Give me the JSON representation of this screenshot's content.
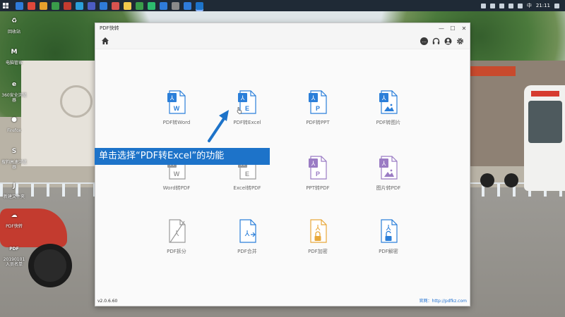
{
  "taskbar": {
    "clock": "21:11",
    "ime": "中",
    "app_colors": [
      "#2f7bd9",
      "#e0483b",
      "#e7a12c",
      "#3a9c4a",
      "#c33b2f",
      "#2b9fd9",
      "#4c5cc2",
      "#2f7bd9",
      "#d9534f",
      "#f2c94c",
      "#3a9c4a",
      "#2dbb6e",
      "#2f7bd9",
      "#8a8a8a",
      "#2f7bd9",
      "#1d73c9"
    ]
  },
  "desktop": {
    "icons": [
      {
        "label": "回收站",
        "glyph": "♻",
        "color": "#5c8fc4",
        "icon": "recycle-bin-icon"
      },
      {
        "label": "电脑管家",
        "glyph": "M",
        "color": "#2d3a8c",
        "icon": "computer-manager-icon"
      },
      {
        "label": "360安全浏览器",
        "glyph": "e",
        "color": "#38a84b",
        "icon": "browser-360-icon"
      },
      {
        "label": "Firefox",
        "glyph": "●",
        "color": "#e66a21",
        "icon": "firefox-icon"
      },
      {
        "label": "搜狗高速浏览器",
        "glyph": "S",
        "color": "#2b7fd9",
        "icon": "sogou-browser-icon"
      },
      {
        "label": "新建文件夹",
        "glyph": "J",
        "color": "#e2c15a",
        "icon": "folder-icon"
      },
      {
        "label": "PDF快转",
        "glyph": "☁",
        "color": "#1e78d6",
        "icon": "pdfkz-app-icon"
      },
      {
        "label": "20190101入员名单",
        "glyph": "PDF",
        "color": "#d93a2f",
        "icon": "pdf-file-icon"
      }
    ]
  },
  "window": {
    "title": "PDF快转",
    "minimize": "—",
    "maximize": "☐",
    "close": "✕",
    "toolbar": {
      "home_icon": "home-icon",
      "right_icons": [
        "chat-icon",
        "headset-icon",
        "user-icon",
        "gear-icon"
      ]
    },
    "tiles": [
      {
        "label": "PDF转Word",
        "badge": "W",
        "color": "#2b7fd9",
        "icon": "pdf-to-word-icon"
      },
      {
        "label": "PDF转Excel",
        "badge": "E",
        "color": "#2b7fd9",
        "icon": "pdf-to-excel-icon"
      },
      {
        "label": "PDF转PPT",
        "badge": "P",
        "color": "#2b7fd9",
        "icon": "pdf-to-ppt-icon"
      },
      {
        "label": "PDF转图片",
        "badge": "img",
        "color": "#2b7fd9",
        "icon": "pdf-to-image-icon"
      },
      {
        "label": "Word转PDF",
        "badge": "W",
        "color": "#9a9a9a",
        "icon": "word-to-pdf-icon"
      },
      {
        "label": "Excel转PDF",
        "badge": "E",
        "color": "#9a9a9a",
        "icon": "excel-to-pdf-icon"
      },
      {
        "label": "PPT转PDF",
        "badge": "P",
        "color": "#9b7cc4",
        "icon": "ppt-to-pdf-icon"
      },
      {
        "label": "图片转PDF",
        "badge": "img",
        "color": "#9b7cc4",
        "icon": "image-to-pdf-icon"
      },
      {
        "label": "PDF拆分",
        "badge": "split",
        "color": "#9a9a9a",
        "icon": "pdf-split-icon"
      },
      {
        "label": "PDF合并",
        "badge": "merge",
        "color": "#2b7fd9",
        "icon": "pdf-merge-icon"
      },
      {
        "label": "PDF加密",
        "badge": "lock",
        "color": "#e8a83a",
        "icon": "pdf-encrypt-icon"
      },
      {
        "label": "PDF解密",
        "badge": "unlock",
        "color": "#2b7fd9",
        "icon": "pdf-decrypt-icon"
      }
    ],
    "version": "v2.0.6.60",
    "website": "官网：http://pdfkz.com"
  },
  "overlay": {
    "hint_text": "单击选择“PDF转Excel”的功能",
    "hint_color": "#1d73c9"
  }
}
